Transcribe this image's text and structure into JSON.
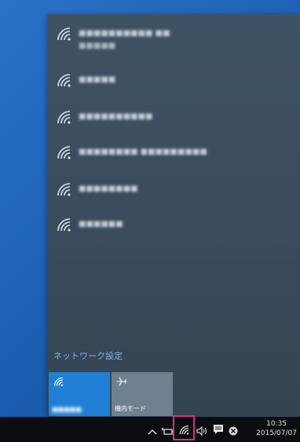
{
  "networks": [
    {
      "name": "■■■■■■■■■■ ■■",
      "sub": "■■■■■"
    },
    {
      "name": "■■■■■",
      "sub": ""
    },
    {
      "name": "■■■■■■■■■■",
      "sub": ""
    },
    {
      "name": "■■■■■■■■ ■■■■■■■■■",
      "sub": ""
    },
    {
      "name": "■■■■■■■■",
      "sub": ""
    },
    {
      "name": "■■■■■■",
      "sub": ""
    }
  ],
  "settings_link": "ネットワーク設定",
  "quick_actions": {
    "wifi_label": "■■■■■",
    "airplane_label": "機内モード"
  },
  "taskbar": {
    "time": "10:35",
    "date": "2015/07/07",
    "icons": [
      "chevron-up-icon",
      "battery-plug-icon",
      "wifi-icon",
      "volume-icon",
      "action-center-icon",
      "close-circle-icon"
    ]
  },
  "colors": {
    "flyout_bg": "#3d5062",
    "accent": "#1e7fd4",
    "link": "#79b6ee",
    "highlight": "#d6317a"
  }
}
